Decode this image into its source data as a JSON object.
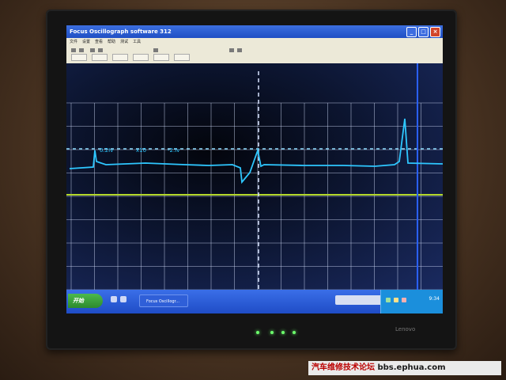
{
  "window": {
    "title": "Focus Oscillograph software 312",
    "buttons": {
      "minimize": "_",
      "maximize": "□",
      "close": "×"
    }
  },
  "menu": {
    "items": [
      "文件",
      "设置",
      "查看",
      "帮助",
      "测试",
      "工具"
    ]
  },
  "oscilloscope": {
    "readout": {
      "voltage": "0.2Iv",
      "multiplier": "x10",
      "offset": "-2.Iv"
    },
    "colors": {
      "trace": "#2ec7ff",
      "grid": "#d9e4ff",
      "dashed_ref": "#8edcff",
      "ground_line": "#b4d82a",
      "right_cursor": "#2a60ff"
    }
  },
  "taskbar": {
    "start_label": "开始",
    "active_window": "Focus Oscillogr...",
    "clock": "9:34"
  },
  "device": {
    "brand": "Lenovo"
  },
  "watermark": {
    "chinese": "汽车维修技术论坛",
    "url": "bbs.ephua.com"
  }
}
